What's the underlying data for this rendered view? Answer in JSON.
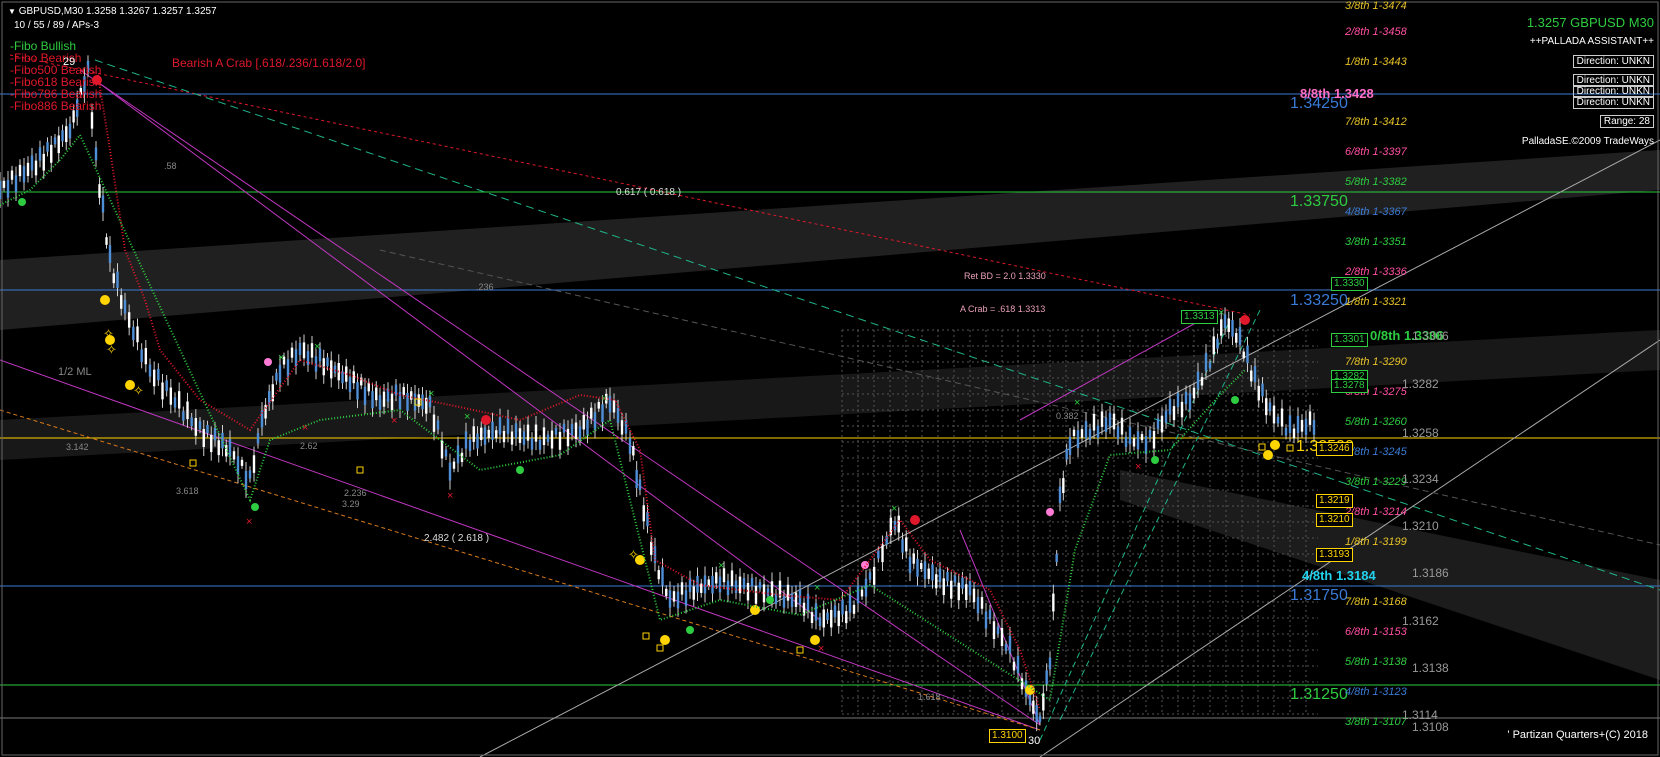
{
  "header": {
    "symbol_line": "GBPUSD,M30  1.3258 1.3267 1.3257 1.3257",
    "indicator_line": "10 / 55 / 89 / APs-3"
  },
  "fibo_legend": [
    {
      "label": "-Fibo Bullish",
      "color": "#2ecc40"
    },
    {
      "label": "-Fibo Bearish",
      "color": "#e0182b"
    },
    {
      "label": "-Fibo500 Bearish",
      "color": "#e0182b"
    },
    {
      "label": "-Fibo618 Bearish",
      "color": "#e0182b"
    },
    {
      "label": "-Fibo786 Bearish",
      "color": "#e0182b"
    },
    {
      "label": "-Fibo886 Bearish",
      "color": "#e0182b"
    }
  ],
  "pattern_label": "Bearish A Crab [.618/.236/1.618/2.0]",
  "pattern_color": "#e0182b",
  "pallada": {
    "title": "1.3257 GBPUSD M30",
    "subtitle": "++PALLADA ASSISTANT++",
    "rows": [
      "Direction: UNKN",
      "Direction: UNKN",
      "Direction: UNKN",
      "Direction: UNKN"
    ],
    "range": "Range: 28",
    "copyright": "PalladaSE.©2009 TradeWays"
  },
  "quarter_levels": [
    {
      "text": "1.34250",
      "color": "#3a7bd5"
    },
    {
      "text": "1.33750",
      "color": "#2ecc40"
    },
    {
      "text": "1.33250",
      "color": "#3a7bd5"
    },
    {
      "text": "1.32500",
      "color": "#ffd400"
    },
    {
      "text": "1.31750",
      "color": "#3a7bd5"
    },
    {
      "text": "1.31250",
      "color": "#2ecc40"
    }
  ],
  "murrey_levels": [
    {
      "text": "3/8th 1-3474",
      "color": "#e6c229"
    },
    {
      "text": "2/8th 1-3458",
      "color": "#ff4fa0"
    },
    {
      "text": "1/8th 1-3443",
      "color": "#e6c229"
    },
    {
      "text": "8/8th 1.3428",
      "color": "#ff6ec7"
    },
    {
      "text": "7/8th 1-3412",
      "color": "#e6c229"
    },
    {
      "text": "6/8th 1-3397",
      "color": "#ff4fa0"
    },
    {
      "text": "5/8th 1-3382",
      "color": "#2ecc40"
    },
    {
      "text": "4/8th 1-3367",
      "color": "#3a7bd5"
    },
    {
      "text": "3/8th 1-3351",
      "color": "#2ecc40"
    },
    {
      "text": "2/8th 1-3336",
      "color": "#ff4fa0"
    },
    {
      "text": "1/8th 1-3321",
      "color": "#e6c229"
    },
    {
      "text": "0/8th 1.3306",
      "color": "#2ecc40"
    },
    {
      "text": "7/8th 1-3290",
      "color": "#e6c229"
    },
    {
      "text": "6/8th 1-3275",
      "color": "#ff4fa0"
    },
    {
      "text": "5/8th 1-3260",
      "color": "#2ecc40"
    },
    {
      "text": "4/8th 1-3245",
      "color": "#3a7bd5"
    },
    {
      "text": "3/8th 1-3229",
      "color": "#2ecc40"
    },
    {
      "text": "2/8th 1-3214",
      "color": "#ff4fa0"
    },
    {
      "text": "1/8th 1-3199",
      "color": "#e6c229"
    },
    {
      "text": "4/8th 1.3184",
      "color": "#22d3ee"
    },
    {
      "text": "7/8th 1-3168",
      "color": "#e6c229"
    },
    {
      "text": "6/8th 1-3153",
      "color": "#ff4fa0"
    },
    {
      "text": "5/8th 1-3138",
      "color": "#2ecc40"
    },
    {
      "text": "4/8th 1-3123",
      "color": "#3a7bd5"
    },
    {
      "text": "3/8th 1-3107",
      "color": "#2ecc40"
    }
  ],
  "price_scale": [
    "1.3306",
    "1.3282",
    "1.3258",
    "1.3234",
    "1.3210",
    "1.3186",
    "1.3162",
    "1.3138",
    "1.3114",
    "1.3108"
  ],
  "boxed_prices": [
    {
      "text": "1.3313",
      "color": "#2ecc40"
    },
    {
      "text": "1.3330",
      "color": "#2ecc40"
    },
    {
      "text": "1.3301",
      "color": "#2ecc40"
    },
    {
      "text": "1.3282",
      "color": "#2ecc40"
    },
    {
      "text": "1.3278",
      "color": "#2ecc40"
    },
    {
      "text": "1.3246",
      "color": "#ffd400"
    },
    {
      "text": "1.3219",
      "color": "#ffd400"
    },
    {
      "text": "1.3210",
      "color": "#ffd400"
    },
    {
      "text": "1.3193",
      "color": "#ffd400"
    },
    {
      "text": "1.3100",
      "color": "#ffd400"
    }
  ],
  "annotations": {
    "ret_bd": "Ret BD = 2.0  1.3330",
    "a_crab": "A Crab = .618  1.3313",
    "fib_0617": "0.617 ( 0.618 )",
    "fib_2482": "2.482 ( 2.618 )",
    "half_ml": "1/2 ML",
    "r_58": ".58",
    "r_236": ".236",
    "r_3142": "3.142",
    "r_3618": "3.618",
    "r_2236": "2.236",
    "r_329": "3.29",
    "r_1618": "1.618",
    "r_382": "0.382",
    "r_262": "2.62",
    "r_30": "30",
    "r_29": "29"
  },
  "footer": "' Partizan Quarters+(C) 2018",
  "colors": {
    "bull": "#2ecc40",
    "bear": "#e0182b",
    "candle": "#cfcfcf",
    "ma_blue": "#4f8fd8"
  }
}
